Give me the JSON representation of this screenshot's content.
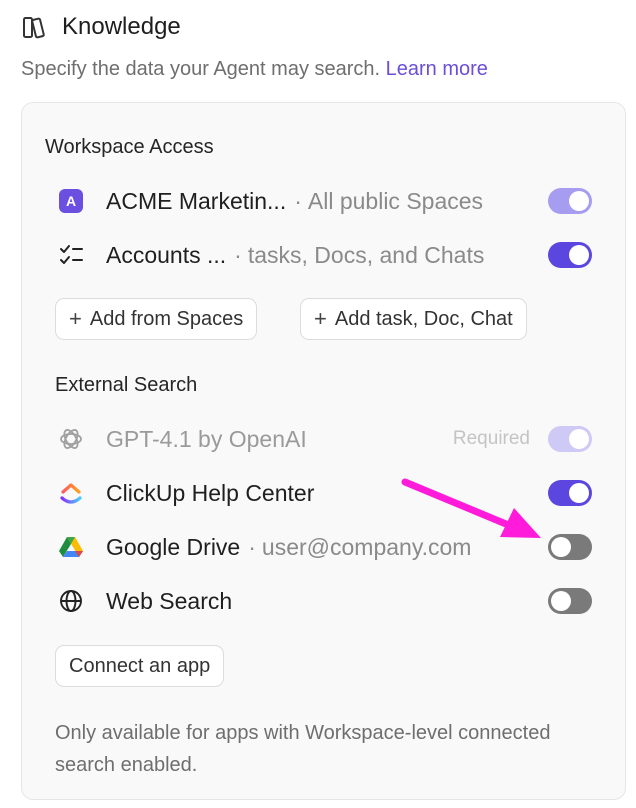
{
  "header": {
    "title": "Knowledge",
    "icon": "books-icon",
    "subtitle": "Specify the data your Agent may search.",
    "learn_more": "Learn more"
  },
  "workspace": {
    "title": "Workspace Access",
    "items": [
      {
        "avatar": "A",
        "name": "ACME Marketin...",
        "meta": "All public Spaces",
        "toggle": "on-light",
        "icon": "workspace-avatar-icon"
      },
      {
        "name": "Accounts ...",
        "meta": "tasks, Docs, and Chats",
        "toggle": "on",
        "icon": "checklist-icon"
      }
    ],
    "add_spaces": "Add from Spaces",
    "add_task": "Add task, Doc, Chat"
  },
  "external": {
    "title": "External Search",
    "items": [
      {
        "name": "GPT-4.1 by OpenAI",
        "badge": "Required",
        "toggle": "on-disabled",
        "icon": "openai-icon"
      },
      {
        "name": "ClickUp Help Center",
        "toggle": "on",
        "icon": "clickup-icon"
      },
      {
        "name": "Google Drive",
        "meta": "user@company.com",
        "toggle": "off",
        "icon": "google-drive-icon"
      },
      {
        "name": "Web Search",
        "toggle": "off",
        "icon": "globe-icon"
      }
    ],
    "connect": "Connect an app"
  },
  "footnote": "Only available for apps with Workspace-level connected search enabled.",
  "colors": {
    "accent": "#5b47e0",
    "link": "#6b4fd8",
    "annotation_arrow": "#ff1bd9"
  }
}
